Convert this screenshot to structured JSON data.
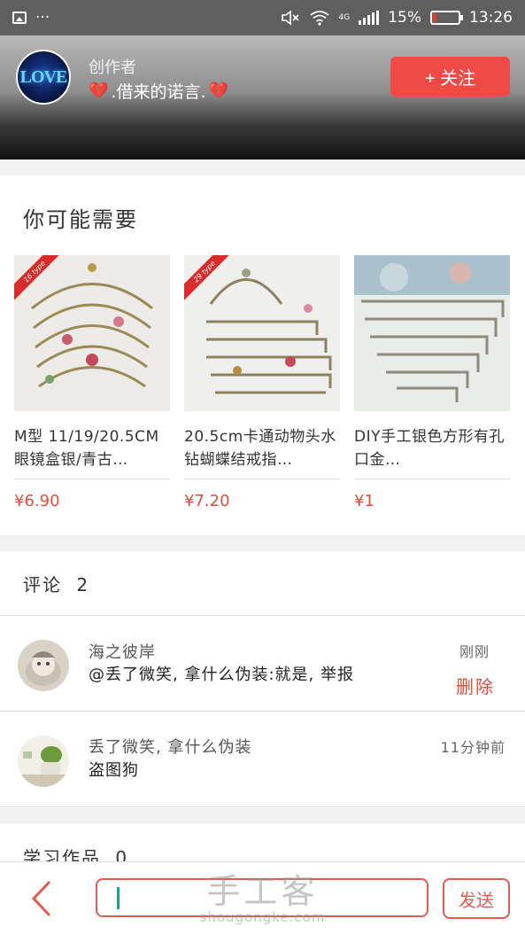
{
  "status_bar": {
    "battery": "15%",
    "battery_level": 0.15,
    "time": "13:26",
    "network": "4G",
    "dots": "···"
  },
  "creator": {
    "avatar_text": "LOVE",
    "role": "创作者",
    "name": ".借来的诺言.",
    "follow_label": "+ 关注"
  },
  "recommend": {
    "title": "你可能需要",
    "products": [
      {
        "badge": "16 type",
        "name": "M型 11/19/20.5CM眼镜盒银/青古…",
        "price": "¥6.90"
      },
      {
        "badge": "29 type",
        "name": "20.5cm卡通动物头水钻蝴蝶结戒指…",
        "price": "¥7.20"
      },
      {
        "badge": "",
        "name": "DIY手工银色方形有孔口金…",
        "price": "¥1"
      }
    ]
  },
  "comments": {
    "header": "评论",
    "count": "2",
    "items": [
      {
        "user": "海之彼岸",
        "text": "@丢了微笑, 拿什么伪装:就是, 举报",
        "time": "刚刚",
        "delete_label": "删除"
      },
      {
        "user": "丢了微笑, 拿什么伪装",
        "text": "盗图狗",
        "time": "11分钟前"
      }
    ]
  },
  "works": {
    "header": "学习作品",
    "count": "0"
  },
  "bottom_bar": {
    "input_value": "",
    "send_label": "发送"
  },
  "watermark": {
    "cn": "手工客",
    "en": "shougongke.com"
  },
  "colors": {
    "accent": "#ef4a45",
    "price": "#e84a3a",
    "status_bar": "#5f5f5f"
  }
}
